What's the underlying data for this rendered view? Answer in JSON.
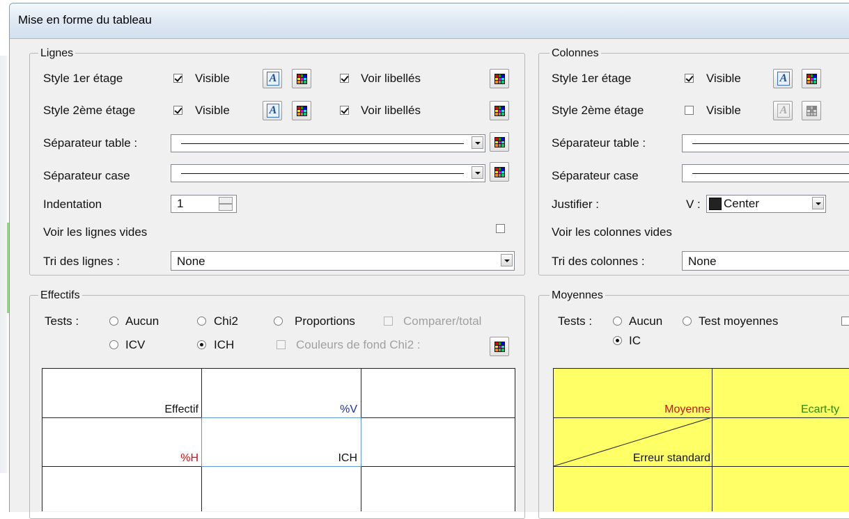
{
  "window": {
    "title": "Mise en forme du tableau"
  },
  "lignes": {
    "legend": "Lignes",
    "style1": {
      "label": "Style 1er étage",
      "visible_label": "Visible",
      "visible_checked": true,
      "voir_label": "Voir libellés",
      "voir_checked": true
    },
    "style2": {
      "label": "Style 2ème étage",
      "visible_label": "Visible",
      "visible_checked": true,
      "voir_label": "Voir libellés",
      "voir_checked": true
    },
    "sep_table": {
      "label": "Séparateur table :"
    },
    "sep_case": {
      "label": "Séparateur case"
    },
    "indentation": {
      "label": "Indentation",
      "value": "1"
    },
    "voir_vides": {
      "label": "Voir les lignes vides",
      "checked": false
    },
    "tri": {
      "label": "Tri des lignes :",
      "value": "None"
    }
  },
  "colonnes": {
    "legend": "Colonnes",
    "style1": {
      "label": "Style 1er étage",
      "visible_label": "Visible",
      "visible_checked": true
    },
    "style2": {
      "label": "Style 2ème étage",
      "visible_label": "Visible",
      "visible_checked": false
    },
    "sep_table": {
      "label": "Séparateur table :"
    },
    "sep_case": {
      "label": "Séparateur case"
    },
    "justifier": {
      "label": "Justifier :",
      "v_label": "V :",
      "value": "Center"
    },
    "voir_vides": {
      "label": "Voir les colonnes vides"
    },
    "tri": {
      "label": "Tri des colonnes :",
      "value": "None"
    }
  },
  "effectifs": {
    "legend": "Effectifs",
    "tests_label": "Tests :",
    "options": {
      "aucun": "Aucun",
      "chi2": "Chi2",
      "proportions": "Proportions",
      "icv": "ICV",
      "ich": "ICH"
    },
    "selected": "ICH",
    "comparer": "Comparer/total",
    "couleurs": "Couleurs de fond Chi2 :",
    "preview": {
      "effectif": "Effectif",
      "pv": "%V",
      "ph": "%H",
      "ich": "ICH"
    }
  },
  "moyennes": {
    "legend": "Moyennes",
    "tests_label": "Tests :",
    "options": {
      "aucun": "Aucun",
      "test_moyennes": "Test moyennes",
      "ic": "IC"
    },
    "selected": "IC",
    "preview": {
      "moyenne": "Moyenne",
      "ecart": "Ecart-ty",
      "erreur": "Erreur standard"
    }
  },
  "colors": {
    "accent_red": "#d01010",
    "accent_blue": "#1a2fa0",
    "accent_green": "#2e8b00",
    "preview_yellow": "#ffff66"
  }
}
